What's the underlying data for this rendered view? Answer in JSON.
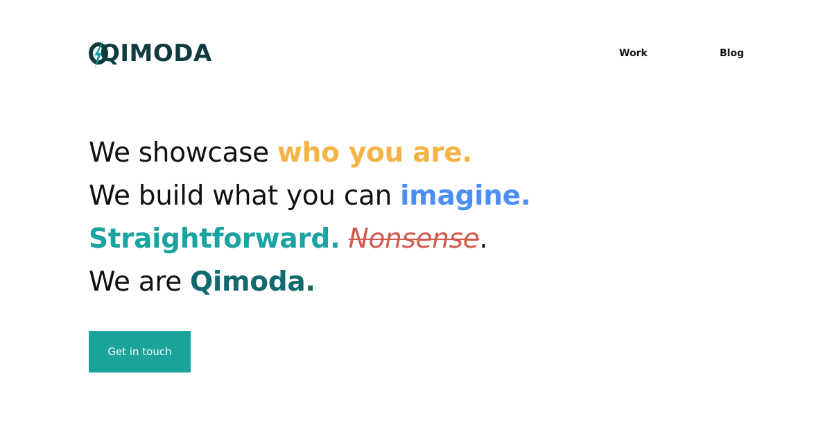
{
  "brand": {
    "name": "QIMODA",
    "color": "#0f3a3f",
    "mark_accent": "#1aa3a1",
    "icon": "qimoda-logo-icon"
  },
  "nav": {
    "items": [
      {
        "label": "Work"
      },
      {
        "label": "Blog"
      }
    ]
  },
  "hero": {
    "line1": {
      "plain": "We showcase ",
      "highlight": "who you are.",
      "color": "#f4b445"
    },
    "line2": {
      "plain": "We build what you can ",
      "highlight": "imagine.",
      "color": "#4d8ef5"
    },
    "line3": {
      "highlight": "Straightforward.",
      "color": "#1aa3a1",
      "strike": "Nonsense",
      "strike_color": "#cf5a4d",
      "end": "."
    },
    "line4": {
      "plain": "We are ",
      "highlight": "Qimoda.",
      "color": "#12696e"
    }
  },
  "cta": {
    "label": "Get in touch",
    "background": "#1ba39c"
  }
}
